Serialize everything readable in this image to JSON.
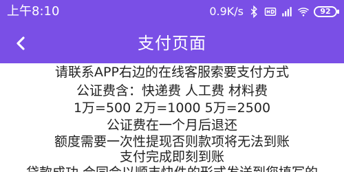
{
  "status_bar": {
    "time": "上午8:10",
    "net_speed": "0.9K/s",
    "battery": "92",
    "icons": [
      "bluetooth-icon",
      "hd-icon",
      "signal-icon",
      "wifi-icon",
      "battery-icon"
    ]
  },
  "app_bar": {
    "title": "支付页面",
    "back_icon": "chevron-left-icon"
  },
  "notice_lines": [
    "请联系APP右边的在线客服索要支付方式",
    "公证费含：快递费 人工费 材料费",
    "1万=500 2万=1000 5万=2500",
    "公证费在一个月后退还",
    "额度需要一次性提现否则款项将无法到账",
    "支付完成即刻到账",
    "贷款成功 合同会以顺丰快件的形式发送到您填写的"
  ],
  "colors": {
    "brand": "#7a4fe6",
    "text": "#222222"
  }
}
